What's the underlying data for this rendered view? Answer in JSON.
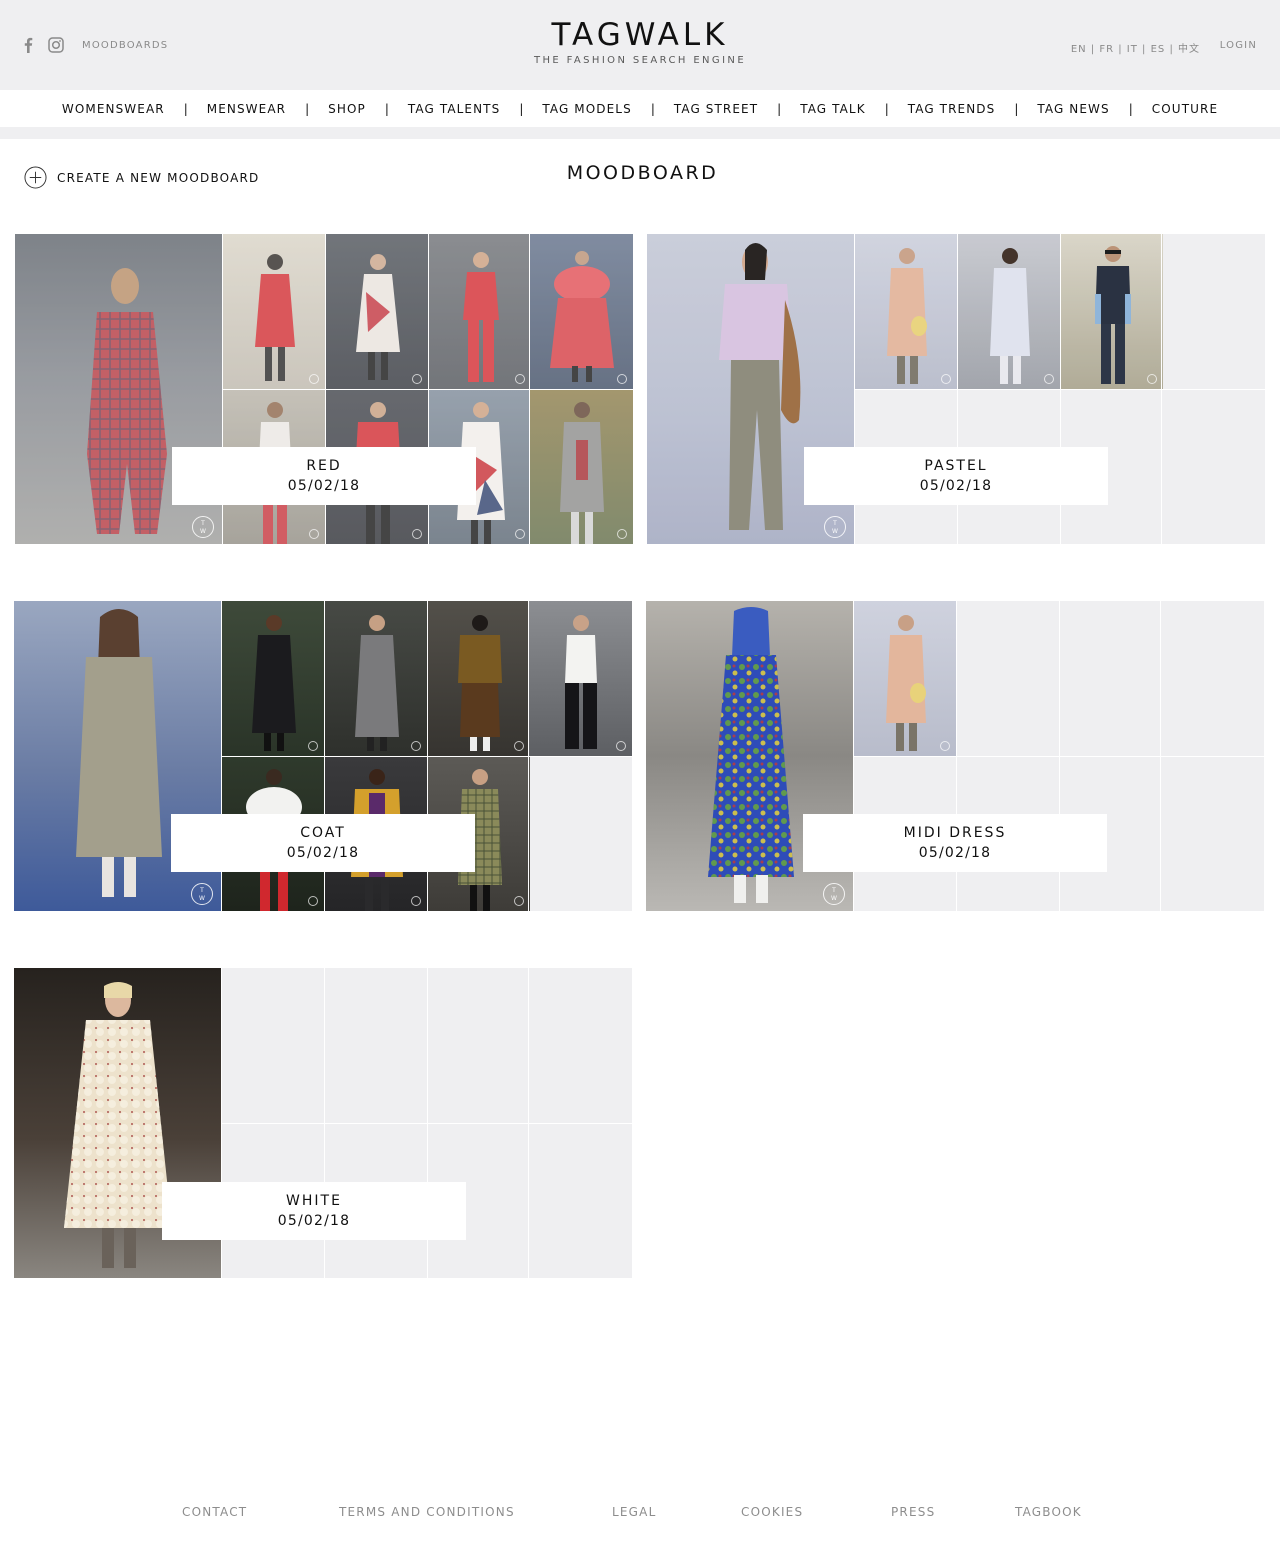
{
  "header": {
    "moodboards_link": "MOODBOARDS",
    "logo_title": "TAGWALK",
    "logo_subtitle": "THE FASHION SEARCH ENGINE",
    "languages": "EN | FR | IT | ES | 中文",
    "login": "LOGIN",
    "icons": {
      "facebook": "facebook-icon",
      "instagram": "instagram-icon"
    }
  },
  "nav": {
    "items": [
      "WOMENSWEAR",
      "MENSWEAR",
      "SHOP",
      "TAG TALENTS",
      "TAG MODELS",
      "TAG STREET",
      "TAG TALK",
      "TAG TRENDS",
      "TAG NEWS",
      "COUTURE"
    ],
    "separator": "|"
  },
  "page": {
    "title": "MOODBOARD",
    "create_label": "CREATE A NEW MOODBOARD",
    "create_icon": "plus-circle-icon"
  },
  "boards": [
    {
      "name": "RED",
      "date": "05/02/18",
      "photos": 9
    },
    {
      "name": "PASTEL",
      "date": "05/02/18",
      "photos": 4
    },
    {
      "name": "COAT",
      "date": "05/02/18",
      "photos": 8
    },
    {
      "name": "MIDI DRESS",
      "date": "05/02/18",
      "photos": 2
    },
    {
      "name": "WHITE",
      "date": "05/02/18",
      "photos": 1
    }
  ],
  "watermark": {
    "top": "T",
    "bottom": "W"
  },
  "footer": {
    "links": [
      "CONTACT",
      "TERMS AND CONDITIONS",
      "LEGAL",
      "COOKIES",
      "PRESS",
      "TAGBOOK"
    ]
  },
  "colors": {
    "header_bg": "#efeff1",
    "empty_tile": "#efeff1",
    "text": "#111111",
    "muted": "#8d8d8d"
  }
}
